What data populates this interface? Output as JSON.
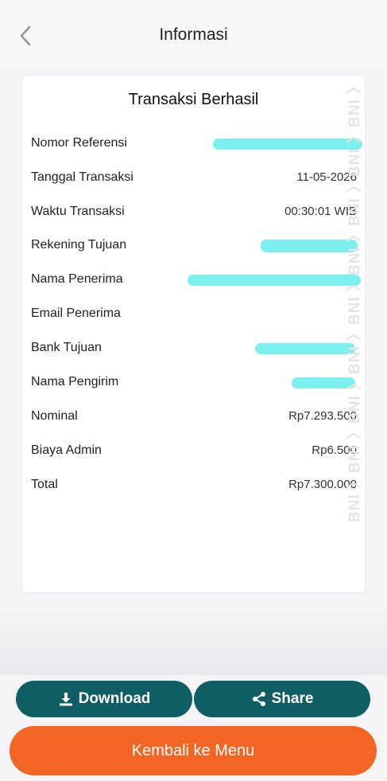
{
  "header": {
    "title": "Informasi"
  },
  "card": {
    "title": "Transaksi Berhasil",
    "rows": [
      {
        "label": "Nomor Referensi",
        "value": ""
      },
      {
        "label": "Tanggal Transaksi",
        "value": "11-05-2026"
      },
      {
        "label": "Waktu Transaksi",
        "value": "00:30:01 WIB"
      },
      {
        "label": "Rekening Tujuan",
        "value": ""
      },
      {
        "label": "Nama Penerima",
        "value": ""
      },
      {
        "label": "Email Penerima",
        "value": ""
      },
      {
        "label": "Bank Tujuan",
        "value": ""
      },
      {
        "label": "Nama Pengirim",
        "value": ""
      },
      {
        "label": "Nominal",
        "value": "Rp7.293.500"
      },
      {
        "label": "Biaya Admin",
        "value": "Rp6.500"
      },
      {
        "label": "Total",
        "value": "Rp7.300.000"
      }
    ],
    "watermark": "BNI"
  },
  "buttons": {
    "download": "Download",
    "share": "Share",
    "menu": "Kembali ke Menu"
  },
  "colors": {
    "primary": "#0e5e63",
    "accent": "#f26524",
    "redaction": "#7cf0ee"
  },
  "icons": {
    "back": "chevron-left-icon",
    "download": "download-icon",
    "share": "share-icon"
  }
}
